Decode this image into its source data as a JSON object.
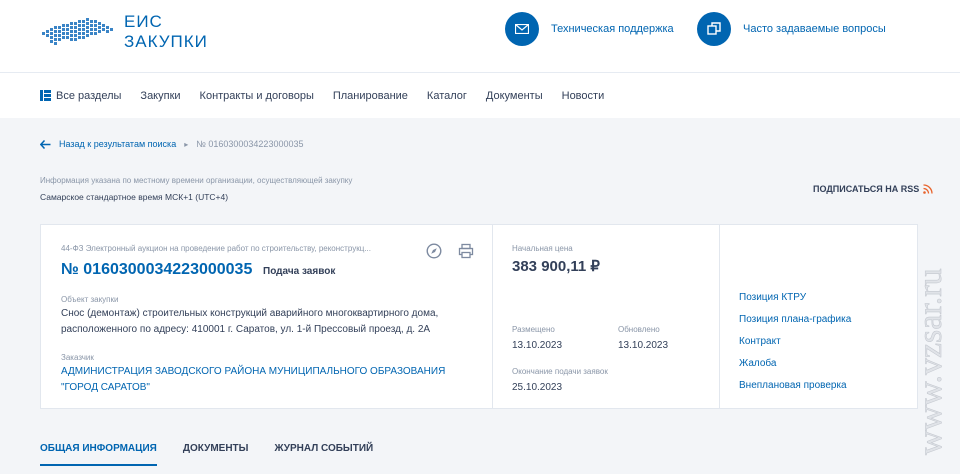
{
  "header": {
    "logo_line1": "ЕИС",
    "logo_line2": "ЗАКУПКИ",
    "support": "Техническая поддержка",
    "faq": "Часто задаваемые вопросы"
  },
  "nav": {
    "items": [
      "Все разделы",
      "Закупки",
      "Контракты и договоры",
      "Планирование",
      "Каталог",
      "Документы",
      "Новости"
    ]
  },
  "breadcrumbs": {
    "back": "Назад к результатам поиска",
    "current": "№ 0160300034223000035"
  },
  "timezone": {
    "note": "Информация указана по местному времени организации, осуществляющей закупку",
    "value": "Самарское стандартное время МСК+1 (UTC+4)"
  },
  "rss_label": "ПОДПИСАТЬСЯ НА RSS",
  "purchase": {
    "law": "44-ФЗ Электронный аукцион на проведение работ по строительству, реконструкц...",
    "number": "№ 0160300034223000035",
    "stage": "Подача заявок",
    "object_label": "Объект закупки",
    "object_line1": "Снос (демонтаж) строительных конструкций аварийного многоквартирного дома,",
    "object_line2": "расположенного по адресу: 410001 г. Саратов, ул. 1-й Прессовый проезд, д. 2А",
    "customer_label": "Заказчик",
    "customer_line1": "АДМИНИСТРАЦИЯ ЗАВОДСКОГО РАЙОНА МУНИЦИПАЛЬНОГО ОБРАЗОВАНИЯ",
    "customer_line2": "\"ГОРОД САРАТОВ\"",
    "price_label": "Начальная цена",
    "price": "383 900,11 ₽",
    "posted_label": "Размещено",
    "posted": "13.10.2023",
    "updated_label": "Обновлено",
    "updated": "13.10.2023",
    "deadline_label": "Окончание подачи заявок",
    "deadline": "25.10.2023"
  },
  "side_links": [
    "Позиция КТРУ",
    "Позиция плана-графика",
    "Контракт",
    "Жалоба",
    "Внеплановая проверка"
  ],
  "tabs": [
    "ОБЩАЯ ИНФОРМАЦИЯ",
    "ДОКУМЕНТЫ",
    "ЖУРНАЛ СОБЫТИЙ"
  ],
  "watermark": "www.vzsar.ru",
  "colors": {
    "accent": "#0065b1",
    "text": "#334059",
    "muted": "#8a96a8",
    "bg": "#f3f5f8"
  }
}
